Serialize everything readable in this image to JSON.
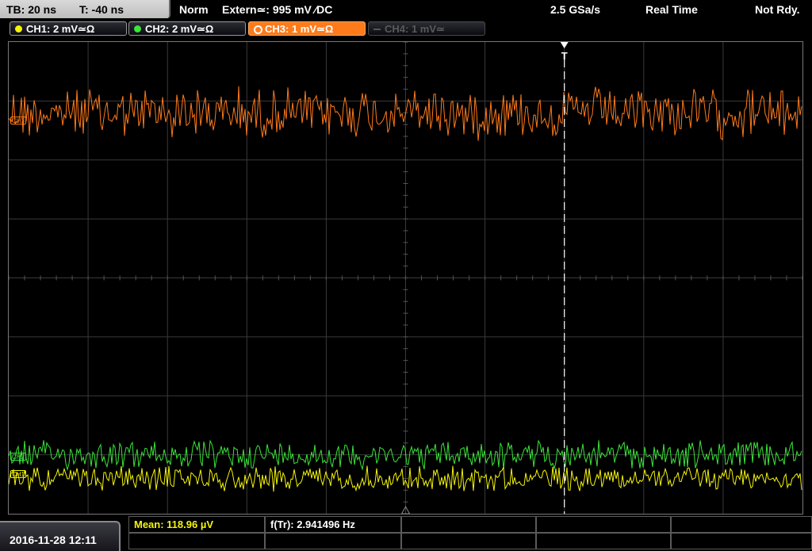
{
  "topbar": {
    "timebase": "TB: 20 ns",
    "trigger_time": "T: -40 ns",
    "mode": "Norm",
    "trigger_source": "Extern≃: 995 mV ∕DC",
    "sample_rate": "2.5 GSa/s",
    "acq_mode": "Real Time",
    "status": "Not Rdy."
  },
  "channels": [
    {
      "label": "CH1: 2 mV≃Ω",
      "color": "#f5f50a",
      "state": "on"
    },
    {
      "label": "CH2: 2 mV≃Ω",
      "color": "#39e639",
      "state": "on"
    },
    {
      "label": "CH3: 1 mV≃Ω",
      "color": "#ff7a1a",
      "state": "active"
    },
    {
      "label": "CH4: 1 mV≃",
      "color": "#555555",
      "state": "off"
    }
  ],
  "screen": {
    "trigger_marker": "T",
    "grid": {
      "cols": 10,
      "rows": 8
    },
    "traces": [
      {
        "channel": "CH3",
        "color": "#ff7a1a",
        "level_div": 1.2,
        "amplitude_div": 0.45
      },
      {
        "channel": "CH2",
        "color": "#39e639",
        "level_div": 7.0,
        "amplitude_div": 0.25
      },
      {
        "channel": "CH1",
        "color": "#f5f50a",
        "level_div": 7.4,
        "amplitude_div": 0.22
      }
    ],
    "markers": [
      {
        "label": "CH3",
        "color": "#ff7a1a"
      },
      {
        "label": "CH2",
        "color": "#39e639"
      },
      {
        "label": "CH1",
        "color": "#f5f50a"
      }
    ]
  },
  "bottom": {
    "datetime": "2016-11-28 12:11",
    "measurements": [
      {
        "text": "Mean: 118.96 µV",
        "color": "#f5f50a"
      },
      {
        "text": "f(Tr): 2.941496 Hz",
        "color": "#ffffff"
      }
    ]
  }
}
